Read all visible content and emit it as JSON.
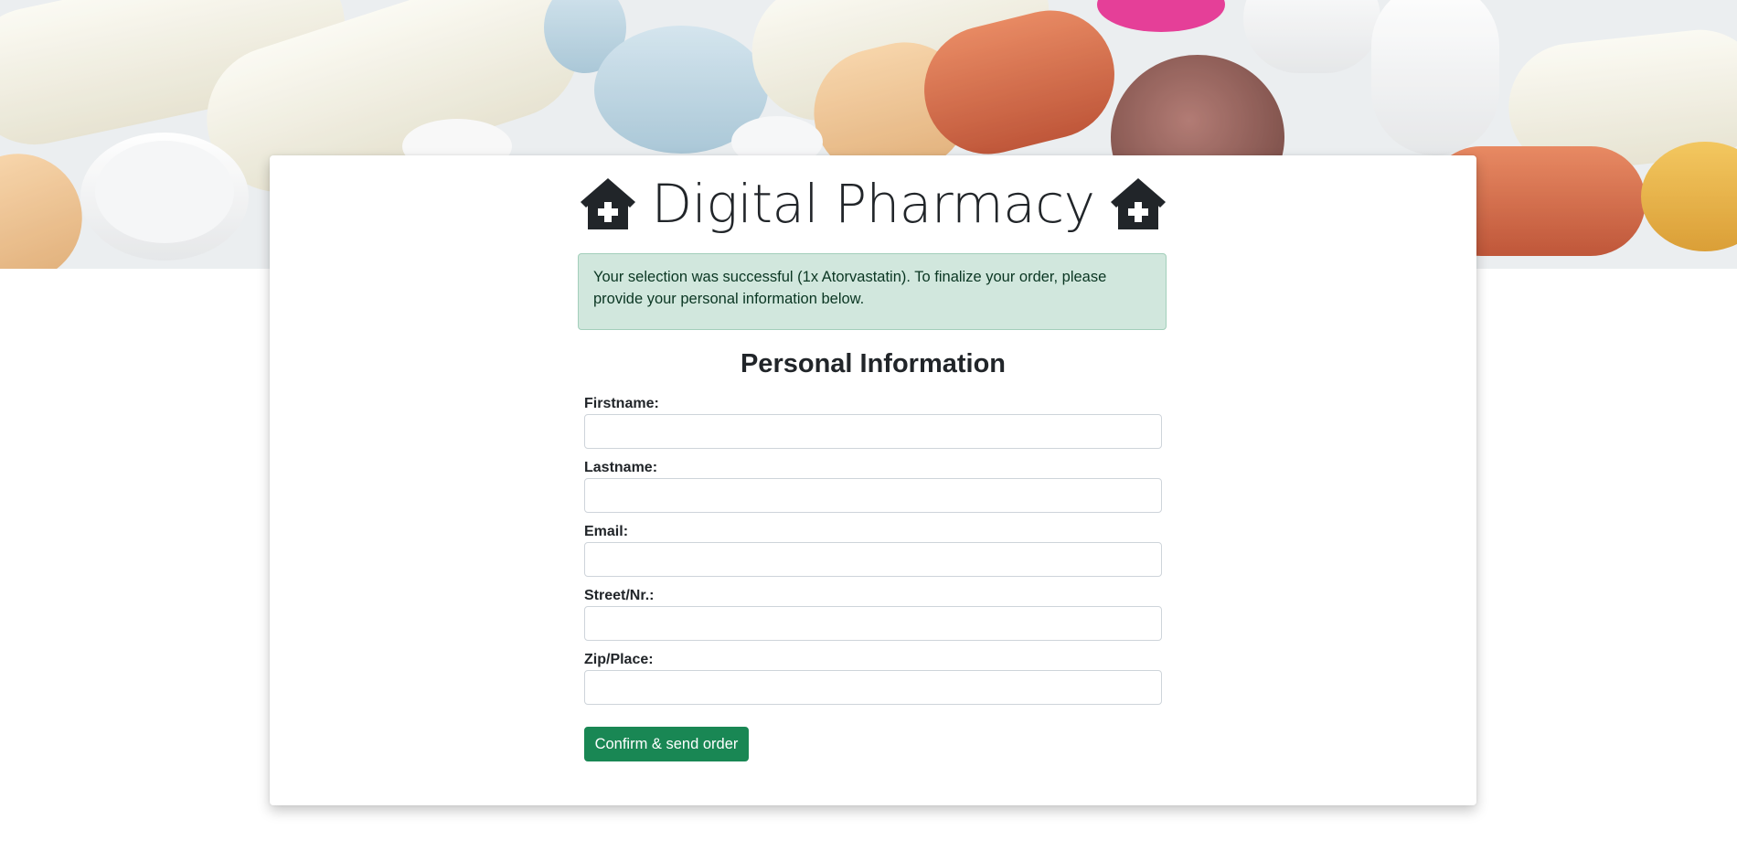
{
  "header": {
    "title": "Digital Pharmacy",
    "icon_left": "pharmacy-home-icon",
    "icon_right": "pharmacy-home-icon",
    "hero_image": "pills-background-image"
  },
  "alert": {
    "text": "Your selection was successful (1x Atorvastatin). To finalize your order, please provide your personal information below.",
    "variant": "success"
  },
  "form": {
    "heading": "Personal Information",
    "fields": [
      {
        "label": "Firstname:",
        "value": "",
        "placeholder": ""
      },
      {
        "label": "Lastname:",
        "value": "",
        "placeholder": ""
      },
      {
        "label": "Email:",
        "value": "",
        "placeholder": ""
      },
      {
        "label": "Street/Nr.:",
        "value": "",
        "placeholder": ""
      },
      {
        "label": "Zip/Place:",
        "value": "",
        "placeholder": ""
      }
    ],
    "submit_label": "Confirm & send order"
  },
  "colors": {
    "primary_button": "#198754",
    "alert_background": "#d1e7dd",
    "alert_text": "#0a3622",
    "text": "#212529"
  }
}
